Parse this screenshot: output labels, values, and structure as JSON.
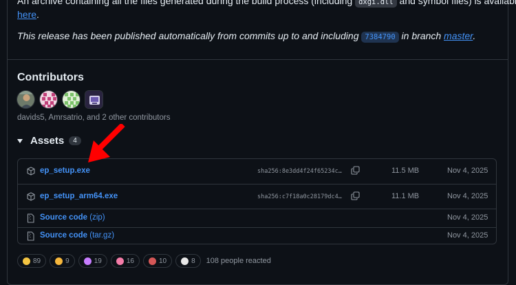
{
  "release_notes": {
    "archive_pre": "An archive containing all the files generated during the build process (including ",
    "archive_code": "dxgi.dll",
    "archive_mid": " and symbol files) is available",
    "archive_link": "here",
    "archive_end": ".",
    "published_pre": "This release has been published automatically from commits up to and including ",
    "published_commit": "7384790",
    "published_mid": " in branch ",
    "published_branch": "master",
    "published_end": "."
  },
  "contributors": {
    "title": "Contributors",
    "avatars": [
      "davids5",
      "Amrsatrio",
      "contributor-3",
      "contributor-4"
    ],
    "summary": "davids5, Amrsatrio, and 2 other contributors"
  },
  "assets": {
    "title": "Assets",
    "count": "4",
    "rows": [
      {
        "name": "ep_setup.exe",
        "sha": "sha256:8e3dd4f24f65234c…",
        "size": "11.5 MB",
        "date": "Nov 4, 2025"
      },
      {
        "name": "ep_setup_arm64.exe",
        "sha": "sha256:c7f18a0c28179dc4…",
        "size": "11.1 MB",
        "date": "Nov 4, 2025"
      },
      {
        "name": "Source code",
        "paren": "(zip)",
        "date": "Nov 4, 2025"
      },
      {
        "name": "Source code",
        "paren": "(tar.gz)",
        "date": "Nov 4, 2025"
      }
    ]
  },
  "reactions": {
    "items": [
      {
        "emoji": "thumbs-up",
        "count": "89"
      },
      {
        "emoji": "laugh",
        "count": "9"
      },
      {
        "emoji": "hooray",
        "count": "19"
      },
      {
        "emoji": "heart",
        "count": "16"
      },
      {
        "emoji": "rocket",
        "count": "10"
      },
      {
        "emoji": "eyes",
        "count": "8"
      }
    ],
    "summary": "108 people reacted"
  },
  "colors": {
    "background": "#0d1117",
    "link": "#4493f8",
    "muted": "#9198a1",
    "border": "#30363d",
    "annotation_arrow": "#ff0000"
  }
}
